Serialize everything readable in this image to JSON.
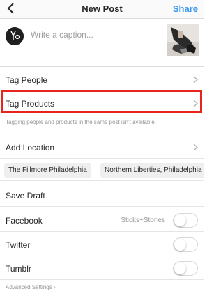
{
  "header": {
    "title": "New Post",
    "share_label": "Share"
  },
  "caption": {
    "placeholder": "Write a caption..."
  },
  "options": {
    "tag_people": "Tag People",
    "tag_products": "Tag Products",
    "tag_note": "Tagging people and products in the same post isn't available.",
    "add_location": "Add Location",
    "save_draft": "Save Draft"
  },
  "location_suggestions": [
    "The Fillmore Philadelphia",
    "Northern Liberties, Philadelphia"
  ],
  "sharing": [
    {
      "label": "Facebook",
      "account": "Sticks+Stones",
      "enabled": false
    },
    {
      "label": "Twitter",
      "account": "",
      "enabled": false
    },
    {
      "label": "Tumblr",
      "account": "",
      "enabled": false
    }
  ],
  "advanced": "Advanced Settings",
  "colors": {
    "accent": "#3897f0",
    "highlight": "#e8251d"
  }
}
